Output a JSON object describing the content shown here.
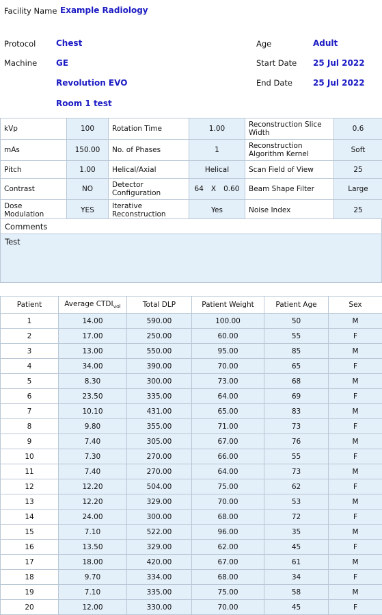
{
  "header": {
    "facility_label": "Facility Name",
    "facility_value": "Example Radiology",
    "protocol_label": "Protocol",
    "protocol_value": "Chest",
    "machine_label": "Machine",
    "machine_value": "GE",
    "machine_model": "Revolution EVO",
    "machine_room": "Room 1 test",
    "age_label": "Age",
    "age_value": "Adult",
    "start_date_label": "Start Date",
    "start_date_value": "25 Jul 2022",
    "end_date_label": "End Date",
    "end_date_value": "25 Jul 2022"
  },
  "parameters": {
    "rows": [
      {
        "k1": "kVp",
        "v1": "100",
        "k2": "Rotation Time",
        "v2": "1.00",
        "k3": "Reconstruction Slice Width",
        "v3": "0.6"
      },
      {
        "k1": "mAs",
        "v1": "150.00",
        "k2": "No. of Phases",
        "v2": "1",
        "k3": "Reconstruction Algorithm Kernel",
        "v3": "Soft"
      },
      {
        "k1": "Pitch",
        "v1": "1.00",
        "k2": "Helical/Axial",
        "v2": "Helical",
        "k3": "Scan Field of View",
        "v3": "25"
      },
      {
        "k1": "Contrast",
        "v1": "NO",
        "k2": "Detector Configuration",
        "v2_a": "64",
        "v2_b": "X",
        "v2_c": "0.60",
        "k3": "Beam Shape Filter",
        "v3": "Large"
      },
      {
        "k1": "Dose Modulation",
        "v1": "YES",
        "k2": "Iterative Reconstruction",
        "v2": "Yes",
        "k3": "Noise Index",
        "v3": "25"
      }
    ]
  },
  "comments": {
    "title": "Comments",
    "text": "Test"
  },
  "patient_table": {
    "headers": {
      "patient": "Patient",
      "ctdi_main": "Average CTDI",
      "ctdi_sub": "vol",
      "dlp": "Total DLP",
      "weight": "Patient Weight",
      "age": "Patient Age",
      "sex": "Sex"
    },
    "rows": [
      {
        "patient": "1",
        "ctdi": "14.00",
        "dlp": "590.00",
        "weight": "100.00",
        "age": "50",
        "sex": "M"
      },
      {
        "patient": "2",
        "ctdi": "17.00",
        "dlp": "250.00",
        "weight": "60.00",
        "age": "55",
        "sex": "F"
      },
      {
        "patient": "3",
        "ctdi": "13.00",
        "dlp": "550.00",
        "weight": "95.00",
        "age": "85",
        "sex": "M"
      },
      {
        "patient": "4",
        "ctdi": "34.00",
        "dlp": "390.00",
        "weight": "70.00",
        "age": "65",
        "sex": "F"
      },
      {
        "patient": "5",
        "ctdi": "8.30",
        "dlp": "300.00",
        "weight": "73.00",
        "age": "68",
        "sex": "M"
      },
      {
        "patient": "6",
        "ctdi": "23.50",
        "dlp": "335.00",
        "weight": "64.00",
        "age": "69",
        "sex": "F"
      },
      {
        "patient": "7",
        "ctdi": "10.10",
        "dlp": "431.00",
        "weight": "65.00",
        "age": "83",
        "sex": "M"
      },
      {
        "patient": "8",
        "ctdi": "9.80",
        "dlp": "355.00",
        "weight": "71.00",
        "age": "73",
        "sex": "F"
      },
      {
        "patient": "9",
        "ctdi": "7.40",
        "dlp": "305.00",
        "weight": "67.00",
        "age": "76",
        "sex": "M"
      },
      {
        "patient": "10",
        "ctdi": "7.30",
        "dlp": "270.00",
        "weight": "66.00",
        "age": "55",
        "sex": "F"
      },
      {
        "patient": "11",
        "ctdi": "7.40",
        "dlp": "270.00",
        "weight": "64.00",
        "age": "73",
        "sex": "M"
      },
      {
        "patient": "12",
        "ctdi": "12.20",
        "dlp": "504.00",
        "weight": "75.00",
        "age": "62",
        "sex": "F"
      },
      {
        "patient": "13",
        "ctdi": "12.20",
        "dlp": "329.00",
        "weight": "70.00",
        "age": "53",
        "sex": "M"
      },
      {
        "patient": "14",
        "ctdi": "24.00",
        "dlp": "300.00",
        "weight": "68.00",
        "age": "72",
        "sex": "F"
      },
      {
        "patient": "15",
        "ctdi": "7.10",
        "dlp": "522.00",
        "weight": "96.00",
        "age": "35",
        "sex": "M"
      },
      {
        "patient": "16",
        "ctdi": "13.50",
        "dlp": "329.00",
        "weight": "62.00",
        "age": "45",
        "sex": "F"
      },
      {
        "patient": "17",
        "ctdi": "18.00",
        "dlp": "420.00",
        "weight": "67.00",
        "age": "61",
        "sex": "M"
      },
      {
        "patient": "18",
        "ctdi": "9.70",
        "dlp": "334.00",
        "weight": "68.00",
        "age": "34",
        "sex": "F"
      },
      {
        "patient": "19",
        "ctdi": "7.10",
        "dlp": "335.00",
        "weight": "75.00",
        "age": "58",
        "sex": "M"
      },
      {
        "patient": "20",
        "ctdi": "12.00",
        "dlp": "330.00",
        "weight": "70.00",
        "age": "45",
        "sex": "F"
      }
    ]
  },
  "colors": {
    "value_blue": "#1b1bc4",
    "cell_fill": "#e3eff9",
    "border": "#b9c7d6"
  }
}
